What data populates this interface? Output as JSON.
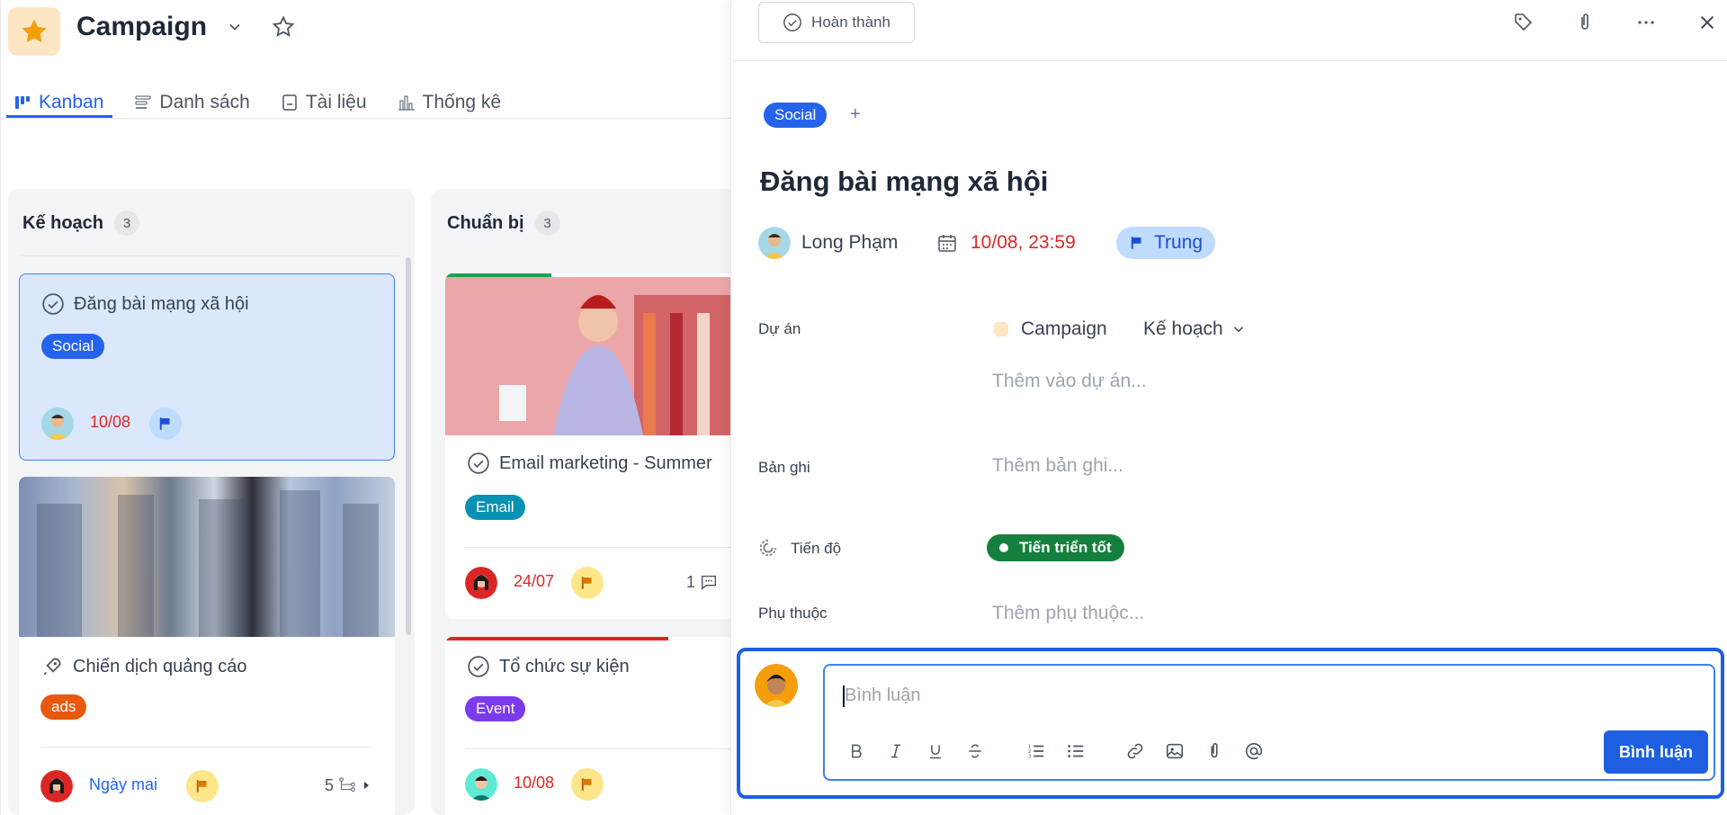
{
  "app": {
    "title": "Campaign",
    "tabs": [
      {
        "label": "Kanban",
        "icon": "kanban-icon"
      },
      {
        "label": "Danh sách",
        "icon": "list-icon"
      },
      {
        "label": "Tài liệu",
        "icon": "document-icon"
      },
      {
        "label": "Thống kê",
        "icon": "chart-icon"
      }
    ]
  },
  "columns": [
    {
      "title": "Kế hoạch",
      "count": "3",
      "cards": [
        {
          "title": "Đăng bài mạng xã hội",
          "tag": "Social",
          "date": "10/08"
        },
        {
          "title": "Chiến dịch quảng cáo",
          "tag": "ads",
          "date": "Ngày mai",
          "subtasks": "5"
        }
      ]
    },
    {
      "title": "Chuẩn bị",
      "count": "3",
      "cards": [
        {
          "title": "Email marketing - Summer",
          "tag": "Email",
          "date": "24/07",
          "comments": "1"
        },
        {
          "title": "Tổ chức sự kiện",
          "tag": "Event",
          "date": "10/08"
        }
      ]
    }
  ],
  "panel": {
    "done_label": "Hoàn thành",
    "tag": "Social",
    "add_tag": "+",
    "title": "Đăng bài mạng xã hội",
    "assignee": "Long Phạm",
    "due": "10/08, 23:59",
    "priority": "Trung",
    "fields": {
      "project_label": "Dự án",
      "project_name": "Campaign",
      "project_stage": "Kế hoạch",
      "project_add": "Thêm vào dự án...",
      "notes_label": "Bản ghi",
      "notes_placeholder": "Thêm bản ghi...",
      "progress_label": "Tiến độ",
      "progress_value": "Tiến triển tốt",
      "deps_label": "Phụ thuộc",
      "deps_placeholder": "Thêm phụ thuộc..."
    },
    "comment": {
      "placeholder": "Bình luận",
      "submit": "Bình luận"
    },
    "colors": {
      "accent": "#1d5fe0",
      "social": "#2563eb",
      "ads": "#ea580c",
      "email": "#0891b2",
      "event": "#7c3aed",
      "danger": "#dc2626",
      "progress": "#15803d"
    }
  }
}
